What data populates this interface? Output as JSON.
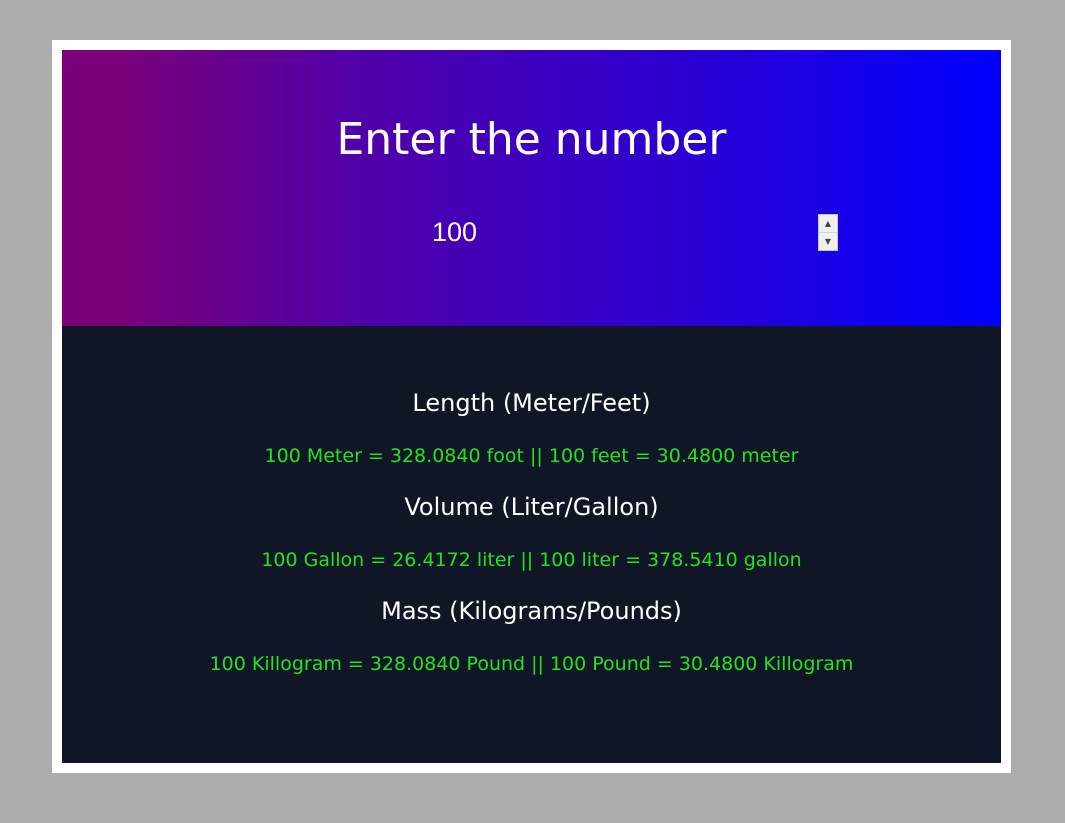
{
  "header": {
    "title": "Enter the number",
    "input_value": "100"
  },
  "sections": [
    {
      "title": "Length (Meter/Feet)",
      "result": "100 Meter = 328.0840 foot || 100 feet = 30.4800 meter"
    },
    {
      "title": "Volume (Liter/Gallon)",
      "result": "100 Gallon = 26.4172 liter || 100 liter = 378.5410 gallon"
    },
    {
      "title": "Mass (Kilograms/Pounds)",
      "result": "100 Killogram = 328.0840 Pound || 100 Pound = 30.4800 Killogram"
    }
  ],
  "colors": {
    "page_background": "#acacac",
    "gradient_start": "#7a007a",
    "gradient_end": "#0000ff",
    "body_background": "#101626",
    "result_text": "#22e322"
  },
  "icons": {
    "spin_up": "triangle-up",
    "spin_down": "triangle-down"
  }
}
